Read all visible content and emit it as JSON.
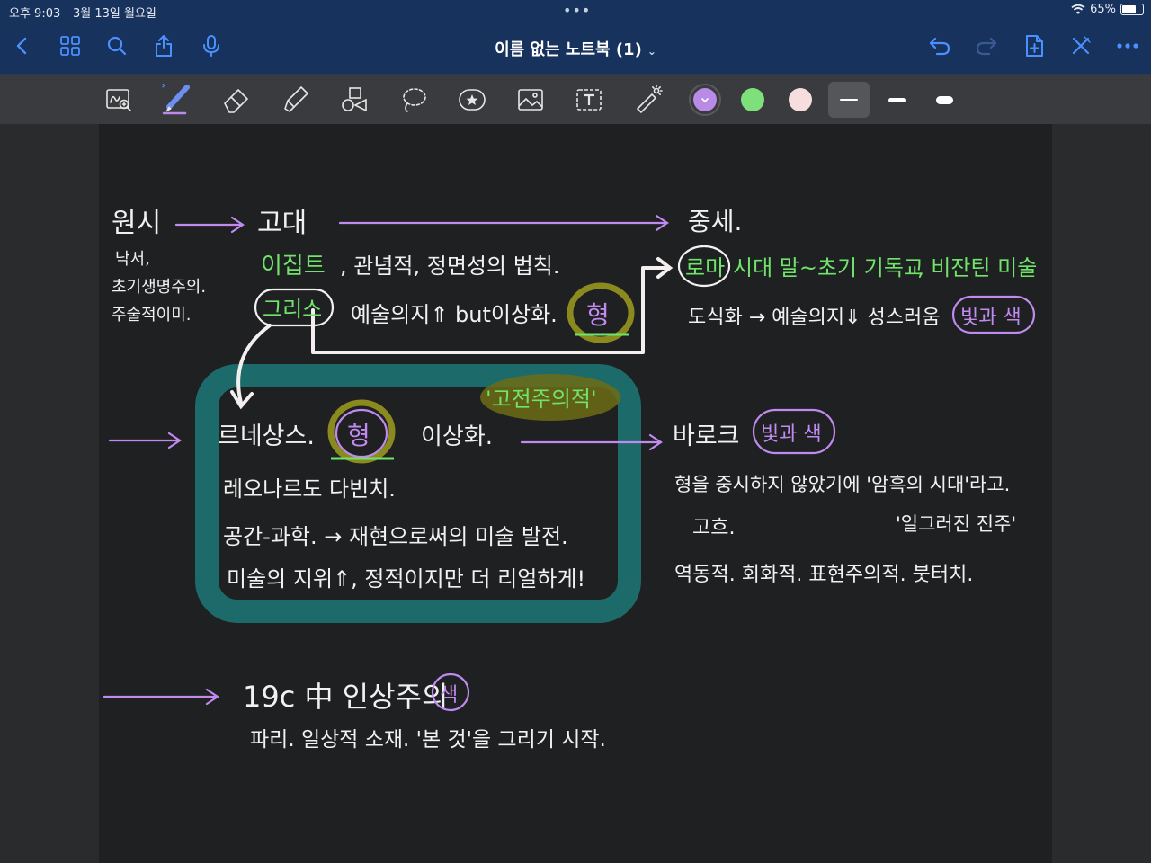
{
  "status_bar": {
    "time": "오후 9:03",
    "date": "3월 13일 월요일",
    "dots": "•••",
    "battery": "65%"
  },
  "nav": {
    "title": "이름 없는 노트북 (1)",
    "title_chevron": "⌄",
    "left_icons": [
      "back-chevron-icon",
      "grid-icon",
      "search-icon",
      "share-icon",
      "microphone-icon"
    ],
    "right_icons": [
      "undo-icon",
      "redo-icon",
      "add-page-icon",
      "close-edit-icon",
      "more-icon"
    ]
  },
  "toolbar": {
    "tools": [
      "handwriting-recognition-icon",
      "pen-icon",
      "eraser-icon",
      "highlighter-icon",
      "shapes-icon",
      "lasso-icon",
      "sticker-icon",
      "image-icon",
      "text-box-icon",
      "laser-pointer-icon"
    ],
    "colors": [
      "#b98ae6",
      "#7ee07a",
      "#f6dede"
    ],
    "selected_color": "#b98ae6",
    "stroke_widths": [
      "thin",
      "medium",
      "thick"
    ],
    "selected_stroke": "thin"
  },
  "note": {
    "colors": {
      "white": "#f1f1f1",
      "purple": "#c08af0",
      "green": "#6fe36a",
      "olive": "#8a8a1e",
      "teal": "#1c6b6a"
    },
    "primitive": {
      "title": "원시",
      "lines": [
        "낙서,",
        "초기생명주의.",
        "주술적이미."
      ]
    },
    "ancient": {
      "title": "고대",
      "egypt": "이집트",
      "egypt_rest": ", 관념적, 정면성의 법칙.",
      "greece": "그리스",
      "greece_rest": "예술의지⇑ but이상화.",
      "form": "형"
    },
    "medieval": {
      "title": "중세.",
      "rome": "로마",
      "rome_rest": "시대 말~초기 기독교",
      "byzantine": ", 비잔틴 미술",
      "line2": "도식화 → 예술의지⇓ 성스러움",
      "light_color": "빛과 색"
    },
    "renaissance": {
      "title": "르네상스.",
      "form": "형",
      "idealize": "이상화.",
      "classicism": "'고전주의적'",
      "lines": [
        "레오나르도 다빈치.",
        "공간-과학. → 재현으로써의 미술 발전.",
        "미술의 지위⇑, 정적이지만 더 리얼하게!"
      ]
    },
    "baroque": {
      "title": "바로크",
      "light_color": "빛과 색",
      "line1": "형을 중시하지 않았기에 '암흑의 시대'라고.",
      "line2_a": "고흐.",
      "line2_b": "'일그러진 진주'",
      "line3": "역동적. 회화적. 표현주의적. 붓터치."
    },
    "c19": {
      "title": "19c 中 인상주의",
      "color": "색",
      "line": "파리. 일상적 소재. '본 것'을 그리기 시작."
    }
  }
}
